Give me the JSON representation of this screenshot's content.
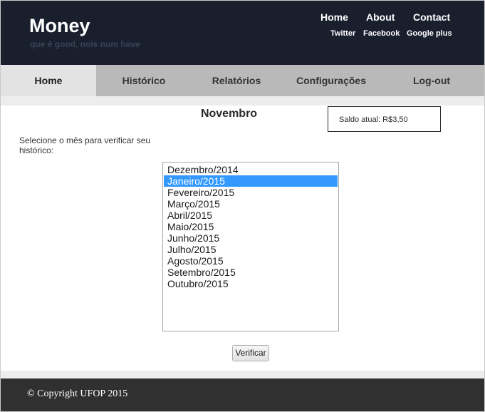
{
  "header": {
    "title": "Money",
    "tagline": "que é good, nois num have",
    "top_links": [
      "Home",
      "About",
      "Contact"
    ],
    "social_links": [
      "Twitter",
      "Facebook",
      "Google plus"
    ]
  },
  "nav": {
    "items": [
      "Home",
      "Histórico",
      "Relatórios",
      "Configurações",
      "Log-out"
    ],
    "active": "Home"
  },
  "main": {
    "month_title": "Novembro",
    "balance": "Saldo atual: R$3,50",
    "instruction": "Selecione o mês para verificar seu histórico:",
    "months": [
      "Dezembro/2014",
      "Janeiro/2015",
      "Fevereiro/2015",
      "Março/2015",
      "Abril/2015",
      "Maio/2015",
      "Junho/2015",
      "Julho/2015",
      "Agosto/2015",
      "Setembro/2015",
      "Outubro/2015"
    ],
    "selected_month": "Janeiro/2015",
    "verify_label": "Verificar"
  },
  "footer": {
    "copyright": "© Copyright UFOP 2015"
  }
}
